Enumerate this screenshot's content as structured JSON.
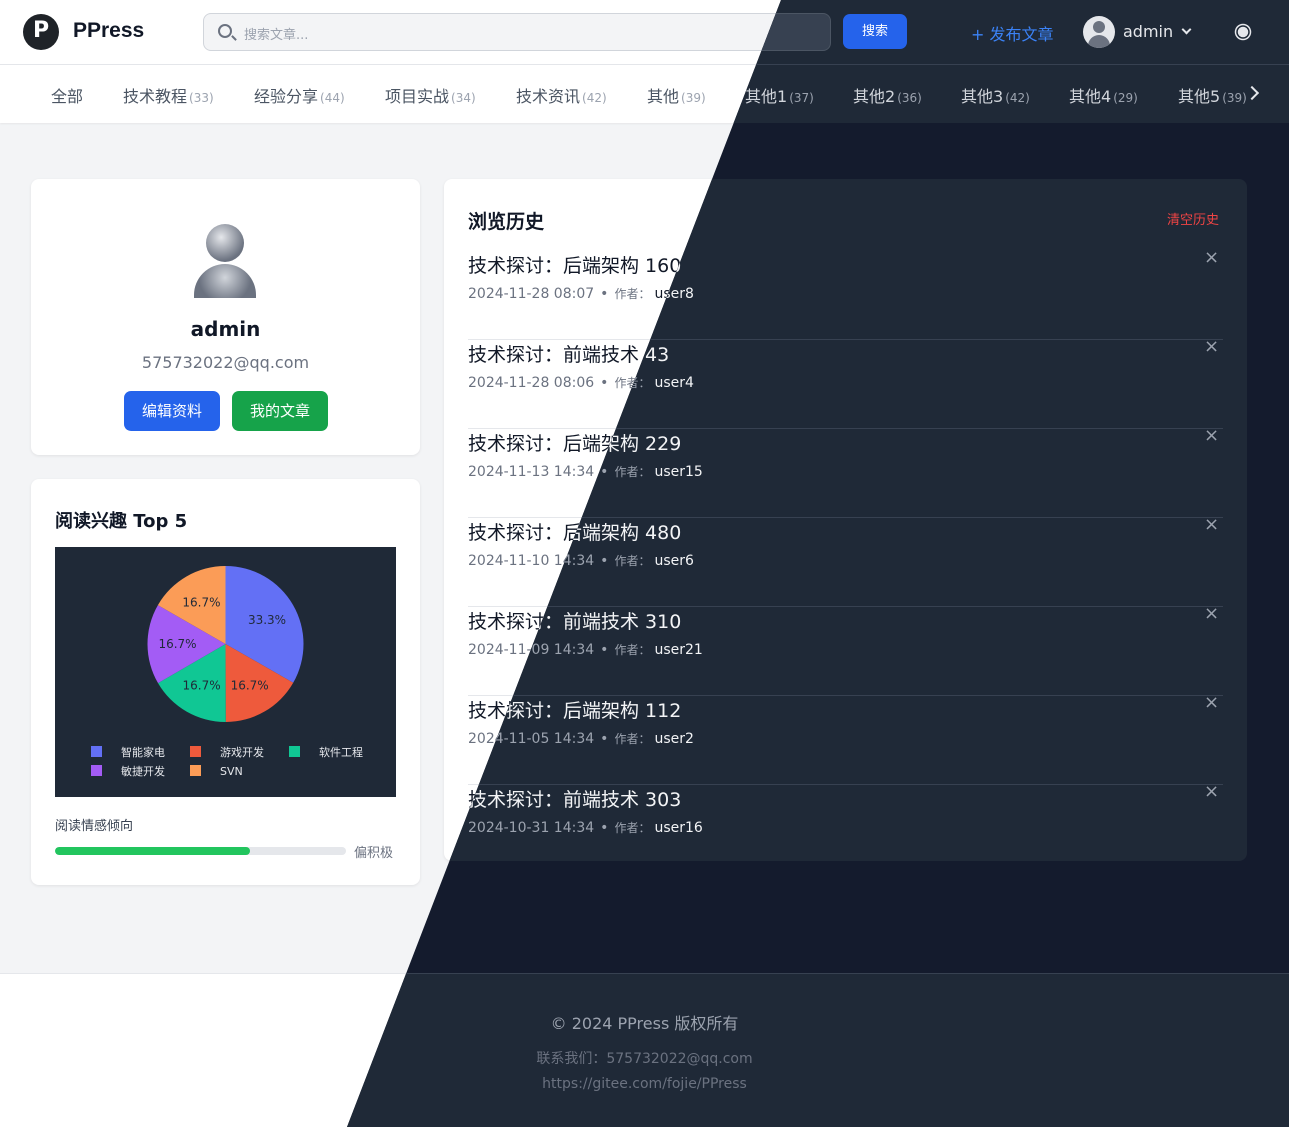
{
  "header": {
    "logo_text": "PPress",
    "search_placeholder": "搜索文章...",
    "search_button": "搜索",
    "publish": "+ 发布文章",
    "user_name": "admin"
  },
  "categories": [
    {
      "label": "全部",
      "count": ""
    },
    {
      "label": "技术教程",
      "count": "(33)"
    },
    {
      "label": "经验分享",
      "count": "(44)"
    },
    {
      "label": "项目实战",
      "count": "(34)"
    },
    {
      "label": "技术资讯",
      "count": "(42)"
    },
    {
      "label": "其他",
      "count": "(39)"
    },
    {
      "label": "其他1",
      "count": "(37)"
    },
    {
      "label": "其他2",
      "count": "(36)"
    },
    {
      "label": "其他3",
      "count": "(42)"
    },
    {
      "label": "其他4",
      "count": "(29)"
    },
    {
      "label": "其他5",
      "count": "(39)"
    }
  ],
  "profile": {
    "name": "admin",
    "email": "575732022@qq.com",
    "edit_button": "编辑资料",
    "my_articles_button": "我的文章"
  },
  "interest": {
    "title": "阅读兴趣 Top 5",
    "sentiment_label": "阅读情感倾向",
    "sentiment_value": 0.67,
    "sentiment_text": "偏积极"
  },
  "chart_data": {
    "type": "pie",
    "title": "",
    "categories": [
      "智能家电",
      "游戏开发",
      "软件工程",
      "敏捷开发",
      "SVN"
    ],
    "values": [
      33.3,
      16.7,
      16.7,
      16.7,
      16.7
    ],
    "labels": [
      "33.3%",
      "16.7%",
      "16.7%",
      "16.7%",
      "16.7%"
    ],
    "colors": [
      "#6370f5",
      "#ee5a3c",
      "#10c794",
      "#a35cf5",
      "#fb9c57"
    ],
    "legend": "bottom"
  },
  "history": {
    "title": "浏览历史",
    "clear": "清空历史",
    "by_label": "作者：",
    "items": [
      {
        "title": "技术探讨：后端架构 160",
        "time": "2024-11-28 08:07",
        "author": "user8"
      },
      {
        "title": "技术探讨：前端技术 43",
        "time": "2024-11-28 08:06",
        "author": "user4"
      },
      {
        "title": "技术探讨：后端架构 229",
        "time": "2024-11-13 14:34",
        "author": "user15"
      },
      {
        "title": "技术探讨：后端架构 480",
        "time": "2024-11-10 14:34",
        "author": "user6"
      },
      {
        "title": "技术探讨：前端技术 310",
        "time": "2024-11-09 14:34",
        "author": "user21"
      },
      {
        "title": "技术探讨：后端架构 112",
        "time": "2024-11-05 14:34",
        "author": "user2"
      },
      {
        "title": "技术探讨：前端技术 303",
        "time": "2024-10-31 14:34",
        "author": "user16"
      }
    ]
  },
  "footer": {
    "copyright": "© 2024 PPress 版权所有",
    "contact": "联系我们：575732022@qq.com",
    "link": "https://gitee.com/fojie/PPress"
  }
}
